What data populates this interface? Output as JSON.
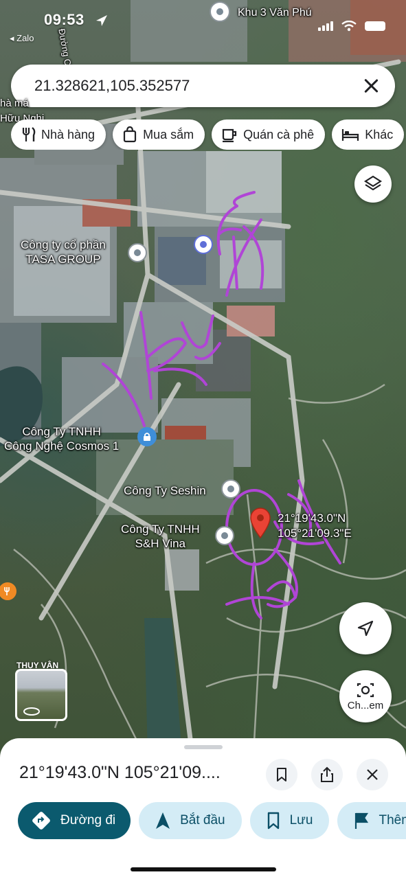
{
  "status_bar": {
    "time": "09:53",
    "back_app": "◂ Zalo"
  },
  "map_header": {
    "top_place": "Khu 3 Văn Phú",
    "road_name": "Đường Ch"
  },
  "search": {
    "query": "21.328621,105.352577"
  },
  "chips": [
    {
      "label": "Nhà hàng",
      "icon": "fork-knife-icon"
    },
    {
      "label": "Mua sắm",
      "icon": "shopping-bag-icon"
    },
    {
      "label": "Quán cà phê",
      "icon": "coffee-cup-icon"
    },
    {
      "label": "Khác",
      "icon": "bed-icon"
    }
  ],
  "map_labels": {
    "tasa": "Công ty cổ phần\nTASA GROUP",
    "cosmos": "Công Ty TNHH\nCông Nghệ Cosmos 1",
    "seshin": "Công Ty Seshin",
    "shvina": "Công Ty TNHH\nS&H Vina",
    "pin_coords": "21°19'43.0\"N\n105°21'09.3\"E",
    "partial_top": "hà má\nHữu Nghi",
    "thuy_van": "THỤY VÂN"
  },
  "handwriting": {
    "word1": "khu CN",
    "word2": "Đất"
  },
  "camera_button": {
    "label": "Ch...em"
  },
  "sheet": {
    "title": "21°19'43.0\"N 105°21'09....",
    "actions": [
      {
        "label": "Đường đi",
        "icon": "directions-icon"
      },
      {
        "label": "Bắt đầu",
        "icon": "navigation-arrow-icon"
      },
      {
        "label": "Lưu",
        "icon": "bookmark-icon"
      },
      {
        "label": "Thêm",
        "icon": "flag-icon"
      }
    ]
  },
  "colors": {
    "primary": "#0b5a6e",
    "chip_bg": "#d4ecf6",
    "pin": "#ea4335",
    "ink": "#b045d6"
  }
}
